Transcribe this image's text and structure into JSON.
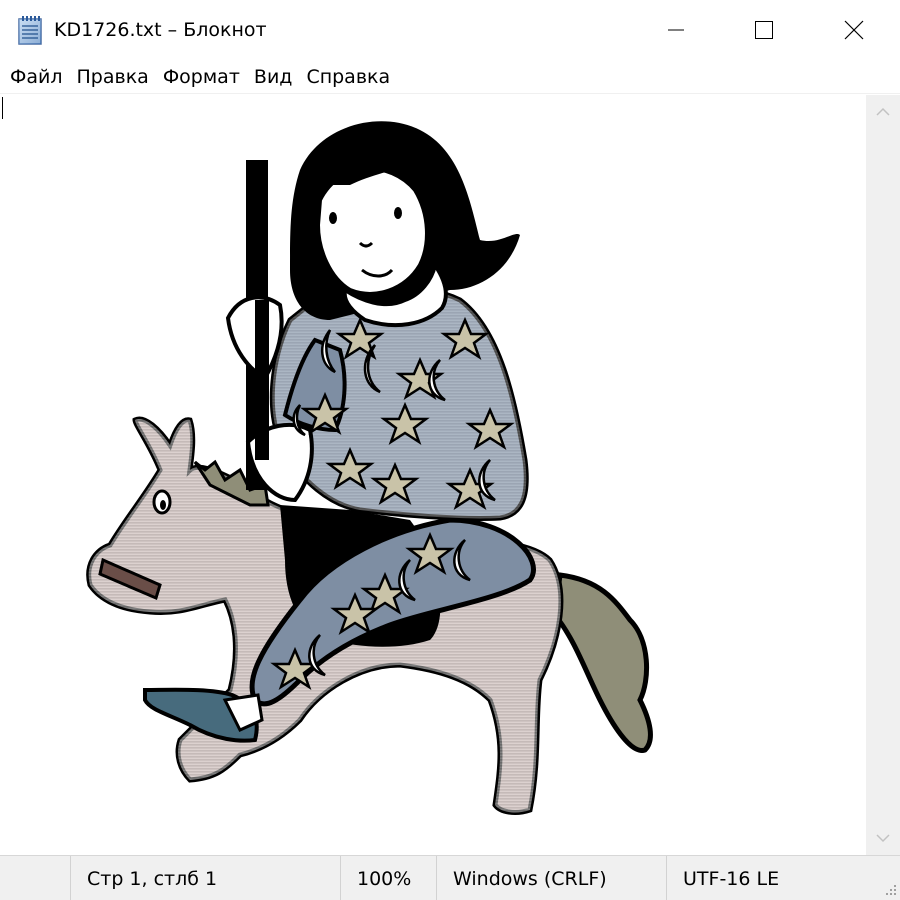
{
  "window": {
    "title": "KD1726.txt – Блокнот",
    "icon": "notepad-icon",
    "controls": [
      "minimize-icon",
      "maximize-icon",
      "close-icon"
    ]
  },
  "menu": {
    "items": [
      "Файл",
      "Правка",
      "Формат",
      "Вид",
      "Справка"
    ]
  },
  "editor": {
    "content_kind": "ascii-art-image",
    "illustration": "girl-in-star-pajamas-on-hobby-horse",
    "colors": {
      "outline": "#000000",
      "horse_body": "#b8a29e",
      "pajamas": "#7e8ea3",
      "stars": "#c9c3a8",
      "horse_tail": "#8f8e78",
      "shoe": "#476b7d",
      "bridle": "#6a4e48"
    }
  },
  "status": {
    "position": "Стр 1, стлб 1",
    "zoom": "100%",
    "line_ending": "Windows (CRLF)",
    "encoding": "UTF-16 LE"
  },
  "colors": {
    "chrome": "#f0f0f0",
    "background": "#ffffff"
  }
}
